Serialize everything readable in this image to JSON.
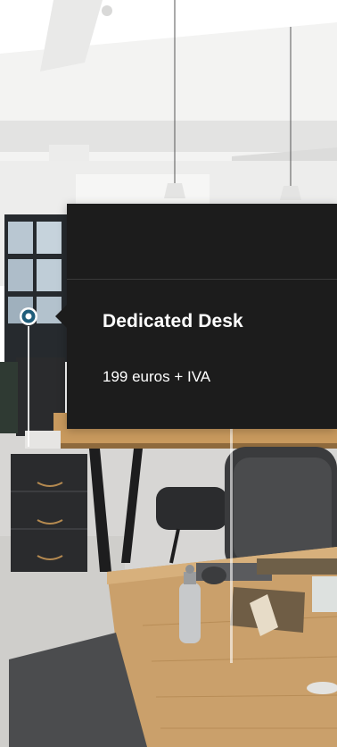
{
  "tooltip": {
    "title": "Dedicated Desk",
    "price": "199 euros + IVA"
  },
  "pin_icon": "location-pin-ring-icon",
  "colors": {
    "tooltip_bg": "#1c1c1c",
    "pin_accent": "#1f5d7a",
    "ceiling": "#f2f2f1",
    "wood": "#c99a5e",
    "cabinet": "#2b2b2d"
  }
}
